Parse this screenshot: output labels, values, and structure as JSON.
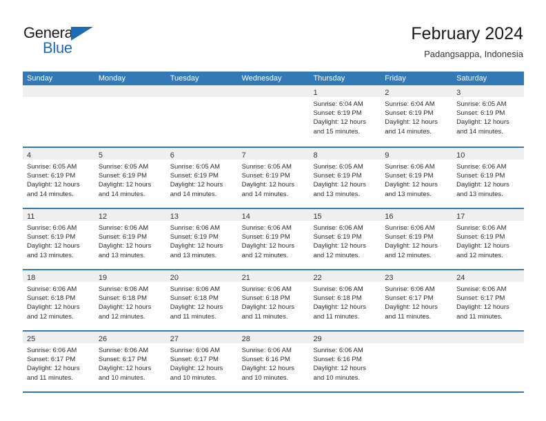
{
  "brand": {
    "name_top": "General",
    "name_bottom": "Blue",
    "triangle_color": "#1c6cb3"
  },
  "header": {
    "title": "February 2024",
    "subtitle": "Padangsappa, Indonesia",
    "accent_color": "#3379b8",
    "band_color": "#efefef"
  },
  "weekdays": [
    "Sunday",
    "Monday",
    "Tuesday",
    "Wednesday",
    "Thursday",
    "Friday",
    "Saturday"
  ],
  "weeks": [
    [
      {
        "day": "",
        "lines": []
      },
      {
        "day": "",
        "lines": []
      },
      {
        "day": "",
        "lines": []
      },
      {
        "day": "",
        "lines": []
      },
      {
        "day": "1",
        "lines": [
          "Sunrise: 6:04 AM",
          "Sunset: 6:19 PM",
          "Daylight: 12 hours",
          "and 15 minutes."
        ]
      },
      {
        "day": "2",
        "lines": [
          "Sunrise: 6:04 AM",
          "Sunset: 6:19 PM",
          "Daylight: 12 hours",
          "and 14 minutes."
        ]
      },
      {
        "day": "3",
        "lines": [
          "Sunrise: 6:05 AM",
          "Sunset: 6:19 PM",
          "Daylight: 12 hours",
          "and 14 minutes."
        ]
      }
    ],
    [
      {
        "day": "4",
        "lines": [
          "Sunrise: 6:05 AM",
          "Sunset: 6:19 PM",
          "Daylight: 12 hours",
          "and 14 minutes."
        ]
      },
      {
        "day": "5",
        "lines": [
          "Sunrise: 6:05 AM",
          "Sunset: 6:19 PM",
          "Daylight: 12 hours",
          "and 14 minutes."
        ]
      },
      {
        "day": "6",
        "lines": [
          "Sunrise: 6:05 AM",
          "Sunset: 6:19 PM",
          "Daylight: 12 hours",
          "and 14 minutes."
        ]
      },
      {
        "day": "7",
        "lines": [
          "Sunrise: 6:05 AM",
          "Sunset: 6:19 PM",
          "Daylight: 12 hours",
          "and 14 minutes."
        ]
      },
      {
        "day": "8",
        "lines": [
          "Sunrise: 6:05 AM",
          "Sunset: 6:19 PM",
          "Daylight: 12 hours",
          "and 13 minutes."
        ]
      },
      {
        "day": "9",
        "lines": [
          "Sunrise: 6:06 AM",
          "Sunset: 6:19 PM",
          "Daylight: 12 hours",
          "and 13 minutes."
        ]
      },
      {
        "day": "10",
        "lines": [
          "Sunrise: 6:06 AM",
          "Sunset: 6:19 PM",
          "Daylight: 12 hours",
          "and 13 minutes."
        ]
      }
    ],
    [
      {
        "day": "11",
        "lines": [
          "Sunrise: 6:06 AM",
          "Sunset: 6:19 PM",
          "Daylight: 12 hours",
          "and 13 minutes."
        ]
      },
      {
        "day": "12",
        "lines": [
          "Sunrise: 6:06 AM",
          "Sunset: 6:19 PM",
          "Daylight: 12 hours",
          "and 13 minutes."
        ]
      },
      {
        "day": "13",
        "lines": [
          "Sunrise: 6:06 AM",
          "Sunset: 6:19 PM",
          "Daylight: 12 hours",
          "and 13 minutes."
        ]
      },
      {
        "day": "14",
        "lines": [
          "Sunrise: 6:06 AM",
          "Sunset: 6:19 PM",
          "Daylight: 12 hours",
          "and 12 minutes."
        ]
      },
      {
        "day": "15",
        "lines": [
          "Sunrise: 6:06 AM",
          "Sunset: 6:19 PM",
          "Daylight: 12 hours",
          "and 12 minutes."
        ]
      },
      {
        "day": "16",
        "lines": [
          "Sunrise: 6:06 AM",
          "Sunset: 6:19 PM",
          "Daylight: 12 hours",
          "and 12 minutes."
        ]
      },
      {
        "day": "17",
        "lines": [
          "Sunrise: 6:06 AM",
          "Sunset: 6:19 PM",
          "Daylight: 12 hours",
          "and 12 minutes."
        ]
      }
    ],
    [
      {
        "day": "18",
        "lines": [
          "Sunrise: 6:06 AM",
          "Sunset: 6:18 PM",
          "Daylight: 12 hours",
          "and 12 minutes."
        ]
      },
      {
        "day": "19",
        "lines": [
          "Sunrise: 6:06 AM",
          "Sunset: 6:18 PM",
          "Daylight: 12 hours",
          "and 12 minutes."
        ]
      },
      {
        "day": "20",
        "lines": [
          "Sunrise: 6:06 AM",
          "Sunset: 6:18 PM",
          "Daylight: 12 hours",
          "and 11 minutes."
        ]
      },
      {
        "day": "21",
        "lines": [
          "Sunrise: 6:06 AM",
          "Sunset: 6:18 PM",
          "Daylight: 12 hours",
          "and 11 minutes."
        ]
      },
      {
        "day": "22",
        "lines": [
          "Sunrise: 6:06 AM",
          "Sunset: 6:18 PM",
          "Daylight: 12 hours",
          "and 11 minutes."
        ]
      },
      {
        "day": "23",
        "lines": [
          "Sunrise: 6:06 AM",
          "Sunset: 6:17 PM",
          "Daylight: 12 hours",
          "and 11 minutes."
        ]
      },
      {
        "day": "24",
        "lines": [
          "Sunrise: 6:06 AM",
          "Sunset: 6:17 PM",
          "Daylight: 12 hours",
          "and 11 minutes."
        ]
      }
    ],
    [
      {
        "day": "25",
        "lines": [
          "Sunrise: 6:06 AM",
          "Sunset: 6:17 PM",
          "Daylight: 12 hours",
          "and 11 minutes."
        ]
      },
      {
        "day": "26",
        "lines": [
          "Sunrise: 6:06 AM",
          "Sunset: 6:17 PM",
          "Daylight: 12 hours",
          "and 10 minutes."
        ]
      },
      {
        "day": "27",
        "lines": [
          "Sunrise: 6:06 AM",
          "Sunset: 6:17 PM",
          "Daylight: 12 hours",
          "and 10 minutes."
        ]
      },
      {
        "day": "28",
        "lines": [
          "Sunrise: 6:06 AM",
          "Sunset: 6:16 PM",
          "Daylight: 12 hours",
          "and 10 minutes."
        ]
      },
      {
        "day": "29",
        "lines": [
          "Sunrise: 6:06 AM",
          "Sunset: 6:16 PM",
          "Daylight: 12 hours",
          "and 10 minutes."
        ]
      },
      {
        "day": "",
        "lines": []
      },
      {
        "day": "",
        "lines": []
      }
    ]
  ]
}
